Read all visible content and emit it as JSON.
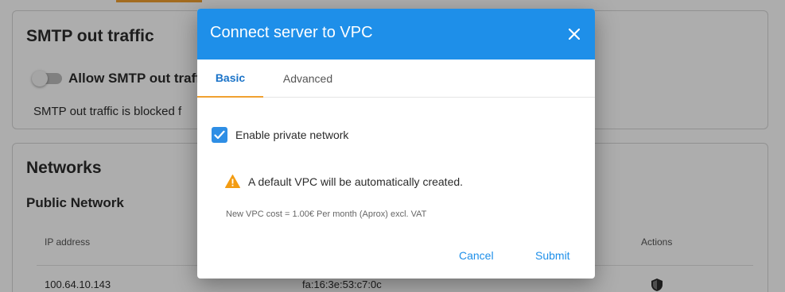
{
  "background": {
    "smtp_card": {
      "title": "SMTP out traffic",
      "toggle_label": "Allow SMTP out traffic",
      "description": "SMTP out traffic is blocked f"
    },
    "networks_card": {
      "title": "Networks",
      "subtitle": "Public Network",
      "columns": {
        "ip": "IP address",
        "actions": "Actions"
      },
      "row": {
        "ip": "100.64.10.143",
        "mac": "fa:16:3e:53:c7:0c"
      }
    }
  },
  "dialog": {
    "title": "Connect server to VPC",
    "tabs": [
      {
        "label": "Basic",
        "active": true
      },
      {
        "label": "Advanced",
        "active": false
      }
    ],
    "checkbox": {
      "label": "Enable private network",
      "checked": true
    },
    "warning": "A default VPC will be automatically created.",
    "cost_note": "New VPC cost = 1.00€ Per month (Aprox) excl. VAT",
    "buttons": {
      "cancel": "Cancel",
      "submit": "Submit"
    }
  },
  "colors": {
    "header_blue": "#1e8fe9",
    "tab_accent": "#f0a030",
    "warning_orange": "#f39c12"
  },
  "icons": [
    "close-icon",
    "check-icon",
    "warning-icon",
    "shield-icon"
  ]
}
